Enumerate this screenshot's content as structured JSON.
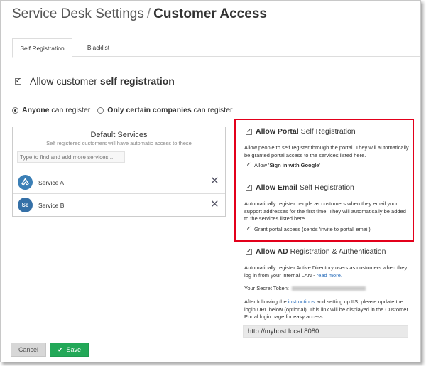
{
  "header": {
    "title_light": "Service Desk Settings",
    "separator": "/",
    "title_strong": "Customer Access"
  },
  "tabs": [
    {
      "label": "Self Registration",
      "active": true
    },
    {
      "label": "Blacklist",
      "active": false
    }
  ],
  "self_registration": {
    "prefix": "Allow customer ",
    "bold": "self registration",
    "checked": true
  },
  "register_scope": {
    "option1_bold": "Anyone",
    "option1_rest": " can register",
    "option1_selected": true,
    "option2_bold": "Only certain companies",
    "option2_rest": " can register",
    "option2_selected": false
  },
  "default_services": {
    "title": "Default Services",
    "subtitle": "Self registered customers will have automatic access to these",
    "placeholder": "Type to find and add more services...",
    "items": [
      {
        "label": "Service A",
        "icon": "service-a-icon",
        "color": "#3b7fb6"
      },
      {
        "label": "Service B",
        "icon": "service-b-icon",
        "color": "#3570a7",
        "initials": "Se"
      }
    ]
  },
  "portal": {
    "head_bold": "Allow Portal",
    "head_rest": " Self Registration",
    "description": "Allow people to self register through the portal. They will automatically be granted portal access to the services listed here.",
    "google_prefix": "Allow '",
    "google_bold": "Sign in with Google",
    "google_suffix": "'"
  },
  "email": {
    "head_bold": "Allow Email",
    "head_rest": " Self Registration",
    "description": "Automatically register people as customers when they email your support addresses for the first time. They will automatically be added to the services listed here.",
    "grant_label": "Grant portal access (sends 'invite to portal' email)"
  },
  "ad": {
    "head_bold": "Allow AD",
    "head_rest": " Registration & Authentication",
    "description": "Automatically register Active Directory users as customers when they log in from your internal LAN - ",
    "read_more": "read more.",
    "token_label": "Your Secret Token:",
    "instructions_prefix": "After following the ",
    "instructions_link": "instructions",
    "instructions_suffix": " and setting up IIS, please update the login URL below (optional). This link will be displayed in the Customer Portal login page for easy access.",
    "url_value": "http://myhost.local:8080"
  },
  "footer": {
    "cancel_label": "Cancel",
    "save_label": "Save"
  },
  "colors": {
    "accent_green": "#23a858",
    "highlight_red": "#e3001b",
    "link_blue": "#2a6ebb"
  }
}
